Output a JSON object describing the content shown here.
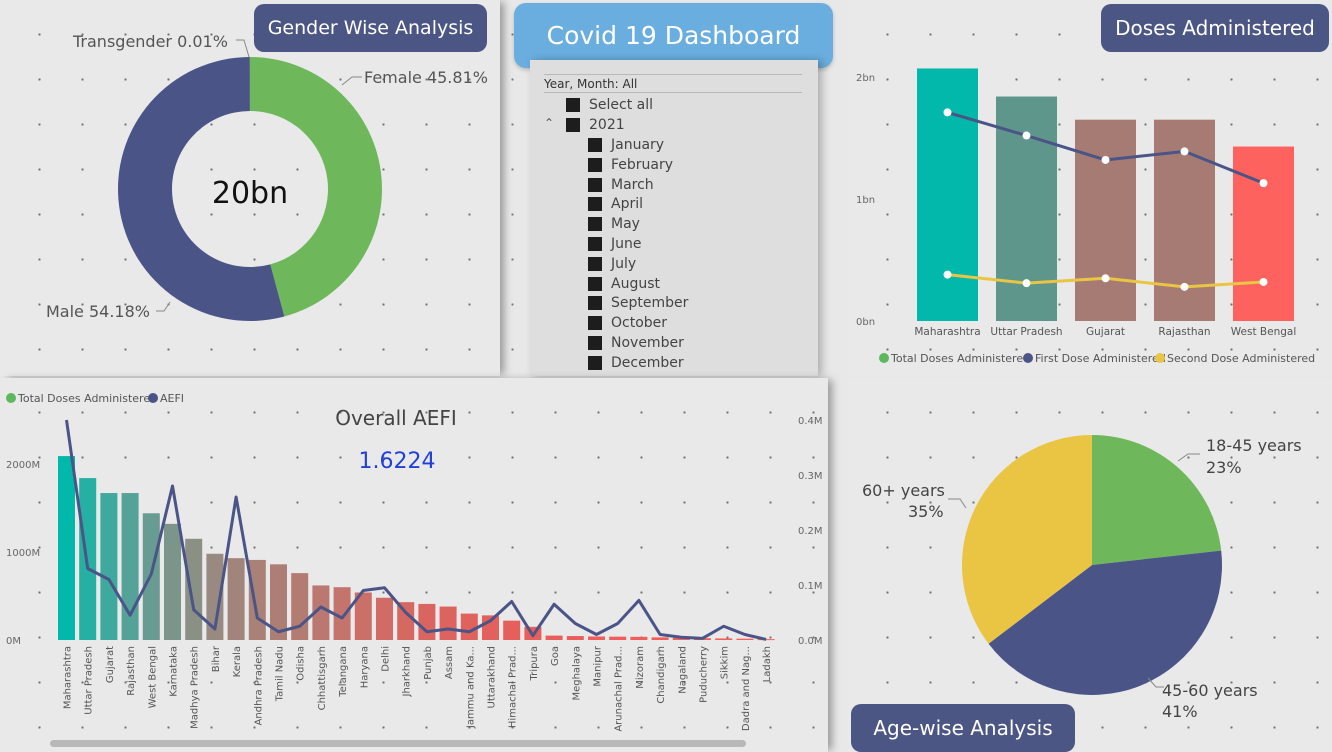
{
  "dashboard_title": "Covid 19 Dashboard",
  "gender": {
    "title": "Gender Wise Analysis",
    "center_value": "20bn",
    "labels": {
      "transgender": "Transgender 0.01%",
      "female": "Female 45.81%",
      "male": "Male 54.18%"
    },
    "colors": {
      "female": "#6eb85b",
      "male": "#4a5487",
      "transgender": "#e9c543"
    }
  },
  "slicer": {
    "header": "Year, Month: All",
    "select_all": "Select all",
    "year": "2021",
    "months": [
      "January",
      "February",
      "March",
      "April",
      "May",
      "June",
      "July",
      "August",
      "September",
      "October",
      "November",
      "December"
    ]
  },
  "doses": {
    "title": "Doses Administered",
    "legend": [
      "Total Doses Administered",
      "First Dose Administered",
      "Second Dose Administered"
    ],
    "legend_colors": [
      "#5cb85c",
      "#4a5487",
      "#e9c543"
    ]
  },
  "aefi": {
    "legend": [
      "Total Doses Administered",
      "AEFI"
    ],
    "legend_colors": [
      "#5cb85c",
      "#4a5487"
    ],
    "overall_label": "Overall AEFI",
    "overall_value": "1.6224"
  },
  "age": {
    "title": "Age-wise Analysis",
    "labels": {
      "a18_45_name": "18-45 years",
      "a18_45_pct": "23%",
      "a60_name": "60+ years",
      "a60_pct": "35%",
      "a45_60_name": "45-60 years",
      "a45_60_pct": "41%"
    }
  },
  "chart_data": [
    {
      "type": "bar",
      "title": "Doses Administered",
      "categories": [
        "Maharashtra",
        "Uttar Pradesh",
        "Gujarat",
        "Rajasthan",
        "West Bengal"
      ],
      "y_ticks": [
        "0bn",
        "1bn",
        "2bn"
      ],
      "ylim": [
        0,
        2.1
      ],
      "bar_colors": [
        "#01b8aa",
        "#5f968b",
        "#a67b73",
        "#a67b73",
        "#fd625e"
      ],
      "series": [
        {
          "name": "Total Doses Administered",
          "type": "bar",
          "values": [
            2.07,
            1.84,
            1.65,
            1.65,
            1.43
          ]
        },
        {
          "name": "First Dose Administered",
          "type": "line",
          "color": "#4a5487",
          "values": [
            1.71,
            1.52,
            1.32,
            1.39,
            1.13
          ]
        },
        {
          "name": "Second Dose Administered",
          "type": "line",
          "color": "#e9c543",
          "values": [
            0.38,
            0.31,
            0.35,
            0.28,
            0.32
          ]
        }
      ],
      "legend": "bottom"
    },
    {
      "type": "bar",
      "title": "",
      "categories": [
        "Maharashtra",
        "Uttar Pradesh",
        "Gujarat",
        "Rajasthan",
        "West Bengal",
        "Karnataka",
        "Madhya Pradesh",
        "Bihar",
        "Kerala",
        "Andhra Pradesh",
        "Tamil Nadu",
        "Odisha",
        "Chhattisgarh",
        "Telangana",
        "Haryana",
        "Delhi",
        "Jharkhand",
        "Punjab",
        "Assam",
        "Jammu and Ka...",
        "Uttarakhand",
        "Himachal Prad...",
        "Tripura",
        "Goa",
        "Meghalaya",
        "Manipur",
        "Arunachal Prad...",
        "Mizoram",
        "Chandigarh",
        "Nagaland",
        "Puducherry",
        "Sikkim",
        "Dadra and Nag...",
        "Ladakh"
      ],
      "y_left_ticks": [
        "0M",
        "1000M",
        "2000M"
      ],
      "y_left_lim": [
        0,
        2500
      ],
      "y_right_ticks": [
        "0.0M",
        "0.1M",
        "0.2M",
        "0.3M",
        "0.4M"
      ],
      "y_right_lim": [
        0,
        0.4
      ],
      "series": [
        {
          "name": "Total Doses Administered",
          "type": "bar",
          "axis": "left",
          "values": [
            2090,
            1840,
            1670,
            1670,
            1440,
            1320,
            1150,
            980,
            930,
            910,
            860,
            760,
            620,
            600,
            540,
            480,
            430,
            410,
            380,
            300,
            280,
            220,
            150,
            50,
            45,
            40,
            38,
            36,
            30,
            25,
            20,
            18,
            15,
            10
          ]
        },
        {
          "name": "AEFI",
          "type": "line",
          "axis": "right",
          "color": "#4a5487",
          "values": [
            0.4,
            0.13,
            0.11,
            0.045,
            0.12,
            0.28,
            0.055,
            0.02,
            0.26,
            0.04,
            0.015,
            0.025,
            0.06,
            0.04,
            0.09,
            0.095,
            0.05,
            0.015,
            0.02,
            0.015,
            0.035,
            0.07,
            0.008,
            0.065,
            0.03,
            0.01,
            0.03,
            0.072,
            0.01,
            0.005,
            0.003,
            0.025,
            0.01,
            0.001
          ]
        }
      ],
      "legend": "top-left"
    },
    {
      "type": "pie",
      "title": "",
      "slices": [
        {
          "label": "18-45 years",
          "value": 23,
          "color": "#6eb85b"
        },
        {
          "label": "45-60 years",
          "value": 41,
          "color": "#4a5487"
        },
        {
          "label": "60+ years",
          "value": 35,
          "color": "#e9c543"
        }
      ]
    },
    {
      "type": "pie",
      "title": "",
      "donut": true,
      "slices": [
        {
          "label": "Female",
          "value": 45.81,
          "color": "#6eb85b"
        },
        {
          "label": "Male",
          "value": 54.18,
          "color": "#4a5487"
        },
        {
          "label": "Transgender",
          "value": 0.01,
          "color": "#e9c543"
        }
      ]
    }
  ]
}
